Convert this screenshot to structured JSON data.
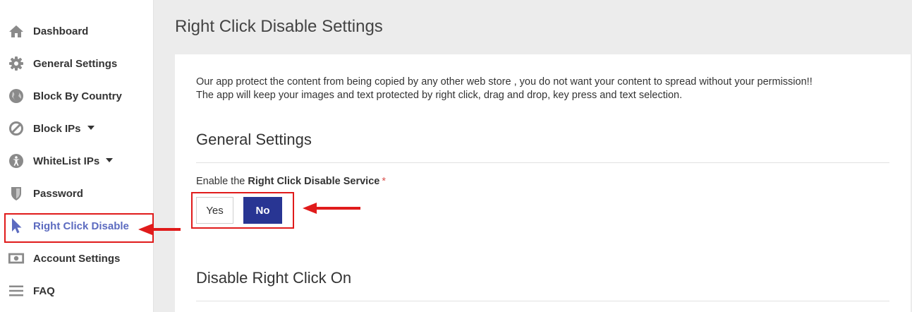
{
  "sidebar": {
    "items": [
      {
        "label": "Dashboard",
        "icon": "home-icon"
      },
      {
        "label": "General Settings",
        "icon": "gear-icon"
      },
      {
        "label": "Block By Country",
        "icon": "globe-icon"
      },
      {
        "label": "Block IPs",
        "icon": "ban-icon",
        "has_dropdown": true
      },
      {
        "label": "WhiteList IPs",
        "icon": "accessibility-icon",
        "has_dropdown": true
      },
      {
        "label": "Password",
        "icon": "shield-icon"
      },
      {
        "label": "Right Click Disable",
        "icon": "cursor-icon",
        "active": true
      },
      {
        "label": "Account Settings",
        "icon": "money-bill-icon"
      },
      {
        "label": "FAQ",
        "icon": "menu-icon"
      }
    ]
  },
  "page": {
    "title": "Right Click Disable Settings",
    "intro_line1": "Our app protect the content from being copied by any other web store , you do not want your content to spread without your permission!!",
    "intro_line2": "The app will keep your images and text protected by right click, drag and drop, key press and text selection."
  },
  "general_settings": {
    "heading": "General Settings",
    "field_label_prefix": "Enable the",
    "field_label_bold": "Right Click Disable Service",
    "required_mark": "*",
    "yes_label": "Yes",
    "no_label": "No",
    "selected": "No"
  },
  "disable_section": {
    "heading": "Disable Right Click On"
  },
  "colors": {
    "accent": "#283593",
    "active_nav": "#5c6bc0",
    "annotation": "#e01b1b",
    "icon_gray": "#8a8a8a"
  }
}
